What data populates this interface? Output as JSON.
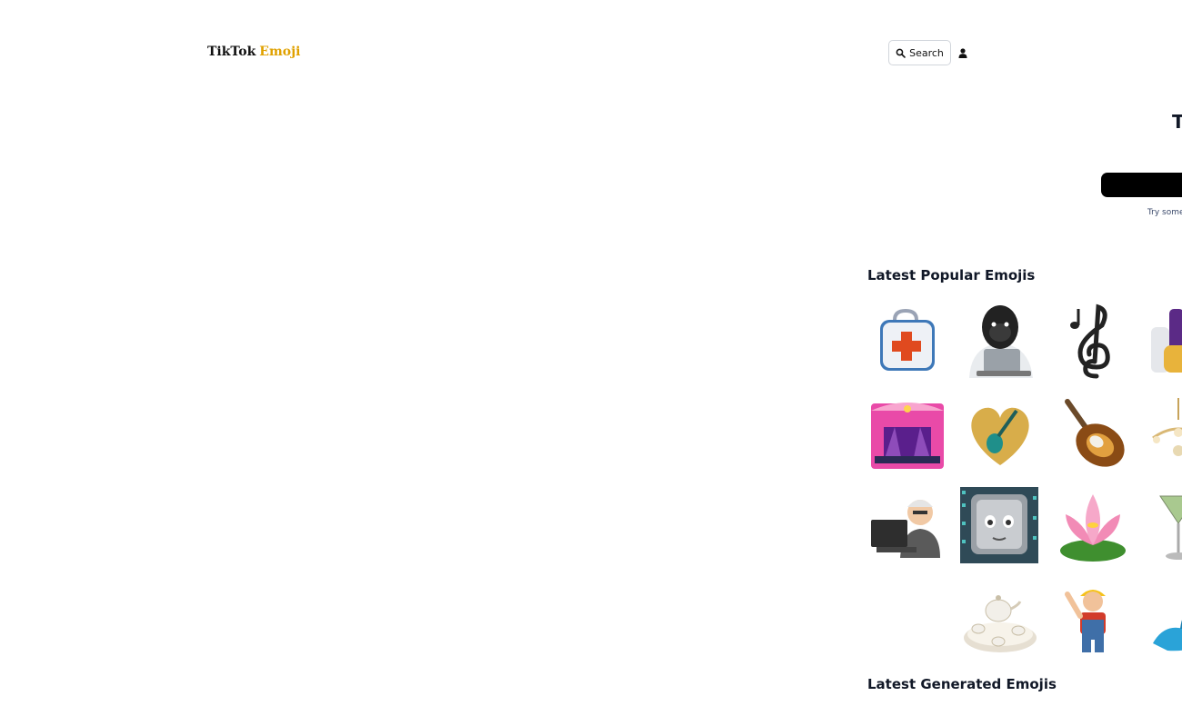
{
  "header": {
    "logo_part1": "TikTok",
    "logo_part2": "Emoji",
    "search_label": "Search",
    "search_icon": "search-icon",
    "user_icon": "user-icon"
  },
  "hero": {
    "title": "T",
    "hint": "Try some"
  },
  "sections": {
    "popular_title": "Latest Popular Emojis",
    "generated_title": "Latest Generated Emojis"
  },
  "colors": {
    "accent": "#e0a100",
    "text": "#111827",
    "hint": "#3b4a6b",
    "input_bg": "#000000"
  },
  "emojis": [
    {
      "name": "first-aid-kit-emoji"
    },
    {
      "name": "gorilla-at-laptop-emoji"
    },
    {
      "name": "treble-clef-emoji"
    },
    {
      "name": "chess-pieces-emoji"
    },
    {
      "name": "theater-stage-emoji"
    },
    {
      "name": "golden-heart-guitar-emoji"
    },
    {
      "name": "electric-guitar-emoji"
    },
    {
      "name": "chandelier-emoji"
    },
    {
      "name": "elderly-man-computer-emoji"
    },
    {
      "name": "computer-screen-face-emoji"
    },
    {
      "name": "lotus-flower-emoji"
    },
    {
      "name": "martini-glass-emoji"
    },
    {
      "name": "empty-emoji"
    },
    {
      "name": "tea-set-emoji"
    },
    {
      "name": "construction-worker-emoji"
    },
    {
      "name": "genie-lamp-emoji"
    }
  ]
}
